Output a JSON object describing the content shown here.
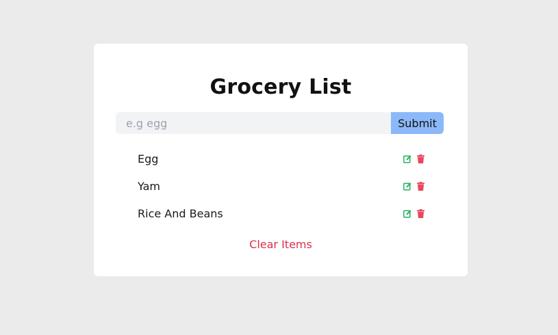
{
  "title": "Grocery List",
  "form": {
    "placeholder": "e.g egg",
    "value": "",
    "submit_label": "Submit"
  },
  "items": [
    {
      "name": "Egg"
    },
    {
      "name": "Yam"
    },
    {
      "name": "Rice And Beans"
    }
  ],
  "actions": {
    "edit_icon": "edit-icon",
    "delete_icon": "trash-icon"
  },
  "clear_label": "Clear Items",
  "colors": {
    "background": "#ebebeb",
    "card": "#ffffff",
    "input_bg": "#f1f3f5",
    "submit_bg": "#8bb8f8",
    "edit": "#22b35c",
    "delete": "#e8485d",
    "clear": "#dc2f4a"
  }
}
